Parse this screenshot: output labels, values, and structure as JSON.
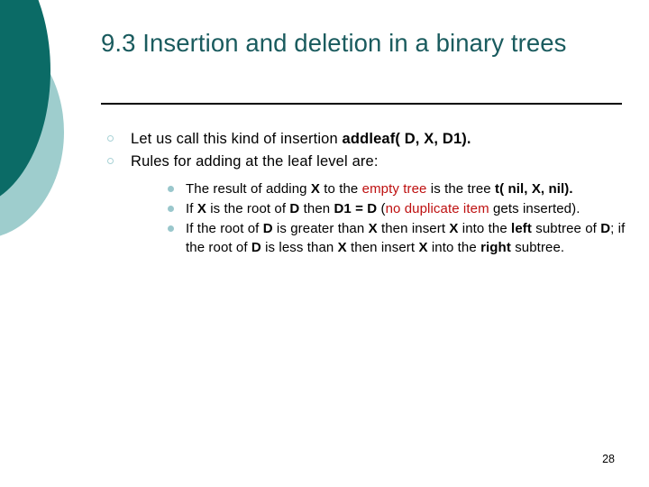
{
  "slide": {
    "title": "9.3 Insertion and deletion in a binary trees",
    "page_number": "28",
    "colors": {
      "title": "#1A5B5E",
      "circle_dark": "#0B6B66",
      "circle_light": "#9ECDCD",
      "bullet_level1": "#A9D2D6",
      "bullet_level2": "#9AC7CC",
      "highlight_red": "#BE1010",
      "rule": "#000000",
      "body_text": "#000000",
      "background": "#FFFFFF"
    }
  },
  "bullets": [
    {
      "id": "bullet-addleaf",
      "runs": [
        {
          "text": "Let us call this kind of insertion ",
          "bold": false,
          "color": "black"
        },
        {
          "text": "addleaf( D, X, D1).",
          "bold": true,
          "color": "black"
        }
      ]
    },
    {
      "id": "bullet-rules",
      "runs": [
        {
          "text": "Rules for adding at the leaf level are:",
          "bold": false,
          "color": "black"
        }
      ]
    }
  ],
  "sub_bullets": [
    {
      "id": "sub-bullet-empty-tree",
      "runs": [
        {
          "text": "The result of adding ",
          "bold": false,
          "color": "black"
        },
        {
          "text": "X",
          "bold": true,
          "color": "black"
        },
        {
          "text": " to the ",
          "bold": false,
          "color": "black"
        },
        {
          "text": "empty tree",
          "bold": false,
          "color": "red"
        },
        {
          "text": " is the tree ",
          "bold": false,
          "color": "black"
        },
        {
          "text": "t( nil, X, nil).",
          "bold": true,
          "color": "black"
        }
      ]
    },
    {
      "id": "sub-bullet-duplicate",
      "runs": [
        {
          "text": "If ",
          "bold": false,
          "color": "black"
        },
        {
          "text": "X",
          "bold": true,
          "color": "black"
        },
        {
          "text": " is the root of ",
          "bold": false,
          "color": "black"
        },
        {
          "text": "D",
          "bold": true,
          "color": "black"
        },
        {
          "text": " then ",
          "bold": false,
          "color": "black"
        },
        {
          "text": "D1 = D",
          "bold": true,
          "color": "black"
        },
        {
          "text": " (",
          "bold": false,
          "color": "black"
        },
        {
          "text": "no duplicate item",
          "bold": false,
          "color": "red"
        },
        {
          "text": " gets inserted).",
          "bold": false,
          "color": "black"
        }
      ]
    },
    {
      "id": "sub-bullet-left-right",
      "runs": [
        {
          "text": "If the root of ",
          "bold": false,
          "color": "black"
        },
        {
          "text": "D",
          "bold": true,
          "color": "black"
        },
        {
          "text": " is greater than ",
          "bold": false,
          "color": "black"
        },
        {
          "text": "X",
          "bold": true,
          "color": "black"
        },
        {
          "text": " then insert ",
          "bold": false,
          "color": "black"
        },
        {
          "text": "X",
          "bold": true,
          "color": "black"
        },
        {
          "text": " into the ",
          "bold": false,
          "color": "black"
        },
        {
          "text": "left",
          "bold": true,
          "color": "black"
        },
        {
          "text": " subtree of ",
          "bold": false,
          "color": "black"
        },
        {
          "text": "D",
          "bold": true,
          "color": "black"
        },
        {
          "text": "; if the root of ",
          "bold": false,
          "color": "black"
        },
        {
          "text": "D",
          "bold": true,
          "color": "black"
        },
        {
          "text": " is less than ",
          "bold": false,
          "color": "black"
        },
        {
          "text": "X",
          "bold": true,
          "color": "black"
        },
        {
          "text": " then insert ",
          "bold": false,
          "color": "black"
        },
        {
          "text": "X",
          "bold": true,
          "color": "black"
        },
        {
          "text": " into the ",
          "bold": false,
          "color": "black"
        },
        {
          "text": "right",
          "bold": true,
          "color": "black"
        },
        {
          "text": " subtree.",
          "bold": false,
          "color": "black"
        }
      ]
    }
  ]
}
